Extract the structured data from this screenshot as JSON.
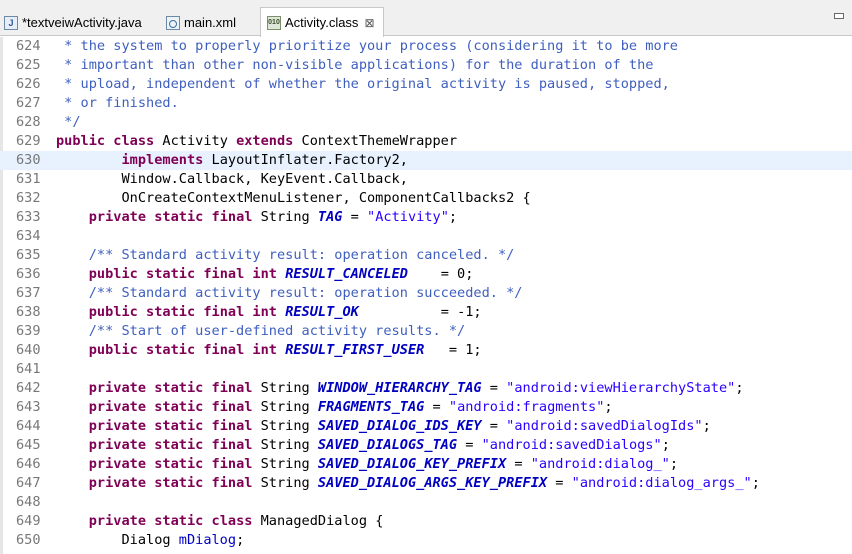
{
  "tabs": [
    {
      "label": "*textveiwActivity.java",
      "icon": "java-file-icon",
      "active": false
    },
    {
      "label": "main.xml",
      "icon": "xml-file-icon",
      "active": false
    },
    {
      "label": "Activity.class",
      "icon": "class-file-icon",
      "active": true
    }
  ],
  "close_glyph": "⊠",
  "colors": {
    "keyword": "#7f0055",
    "comment": "#3f5fbf",
    "string": "#2a00ff",
    "field": "#0000c0",
    "line_number": "#787878",
    "current_line": "#e8f2fe"
  },
  "editor": {
    "current_line": 630,
    "lines": [
      {
        "num": "624",
        "tokens": [
          {
            "t": " * the system to properly prioritize your process (considering it to be more",
            "c": "c"
          }
        ]
      },
      {
        "num": "625",
        "tokens": [
          {
            "t": " * important than other non-visible applications) for the duration of the",
            "c": "c"
          }
        ]
      },
      {
        "num": "626",
        "tokens": [
          {
            "t": " * upload, independent of whether the original activity is paused, stopped,",
            "c": "c"
          }
        ]
      },
      {
        "num": "627",
        "tokens": [
          {
            "t": " * or finished.",
            "c": "c"
          }
        ]
      },
      {
        "num": "628",
        "tokens": [
          {
            "t": " */",
            "c": "c"
          }
        ]
      },
      {
        "num": "629",
        "tokens": [
          {
            "t": "public class",
            "c": "k"
          },
          {
            "t": " Activity ",
            "c": ""
          },
          {
            "t": "extends",
            "c": "k"
          },
          {
            "t": " ContextThemeWrapper",
            "c": ""
          }
        ]
      },
      {
        "num": "630",
        "tokens": [
          {
            "t": "        ",
            "c": ""
          },
          {
            "t": "implements",
            "c": "k"
          },
          {
            "t": " LayoutInflater.Factory2,",
            "c": ""
          }
        ]
      },
      {
        "num": "631",
        "tokens": [
          {
            "t": "        Window.Callback, KeyEvent.Callback,",
            "c": ""
          }
        ]
      },
      {
        "num": "632",
        "tokens": [
          {
            "t": "        OnCreateContextMenuListener, ComponentCallbacks2 {",
            "c": ""
          }
        ]
      },
      {
        "num": "633",
        "tokens": [
          {
            "t": "    ",
            "c": ""
          },
          {
            "t": "private static final",
            "c": "k"
          },
          {
            "t": " String ",
            "c": ""
          },
          {
            "t": "TAG",
            "c": "f"
          },
          {
            "t": " = ",
            "c": ""
          },
          {
            "t": "\"Activity\"",
            "c": "s"
          },
          {
            "t": ";",
            "c": ""
          }
        ]
      },
      {
        "num": "634",
        "tokens": []
      },
      {
        "num": "635",
        "tokens": [
          {
            "t": "    /** Standard activity result: operation canceled. */",
            "c": "c"
          }
        ]
      },
      {
        "num": "636",
        "tokens": [
          {
            "t": "    ",
            "c": ""
          },
          {
            "t": "public static final int",
            "c": "k"
          },
          {
            "t": " ",
            "c": ""
          },
          {
            "t": "RESULT_CANCELED",
            "c": "f"
          },
          {
            "t": "    = 0;",
            "c": ""
          }
        ]
      },
      {
        "num": "637",
        "tokens": [
          {
            "t": "    /** Standard activity result: operation succeeded. */",
            "c": "c"
          }
        ]
      },
      {
        "num": "638",
        "tokens": [
          {
            "t": "    ",
            "c": ""
          },
          {
            "t": "public static final int",
            "c": "k"
          },
          {
            "t": " ",
            "c": ""
          },
          {
            "t": "RESULT_OK",
            "c": "f"
          },
          {
            "t": "          = -1;",
            "c": ""
          }
        ]
      },
      {
        "num": "639",
        "tokens": [
          {
            "t": "    /** Start of user-defined activity results. */",
            "c": "c"
          }
        ]
      },
      {
        "num": "640",
        "tokens": [
          {
            "t": "    ",
            "c": ""
          },
          {
            "t": "public static final int",
            "c": "k"
          },
          {
            "t": " ",
            "c": ""
          },
          {
            "t": "RESULT_FIRST_USER",
            "c": "f"
          },
          {
            "t": "   = 1;",
            "c": ""
          }
        ]
      },
      {
        "num": "641",
        "tokens": []
      },
      {
        "num": "642",
        "tokens": [
          {
            "t": "    ",
            "c": ""
          },
          {
            "t": "private static final",
            "c": "k"
          },
          {
            "t": " String ",
            "c": ""
          },
          {
            "t": "WINDOW_HIERARCHY_TAG",
            "c": "f"
          },
          {
            "t": " = ",
            "c": ""
          },
          {
            "t": "\"android:viewHierarchyState\"",
            "c": "s"
          },
          {
            "t": ";",
            "c": ""
          }
        ]
      },
      {
        "num": "643",
        "tokens": [
          {
            "t": "    ",
            "c": ""
          },
          {
            "t": "private static final",
            "c": "k"
          },
          {
            "t": " String ",
            "c": ""
          },
          {
            "t": "FRAGMENTS_TAG",
            "c": "f"
          },
          {
            "t": " = ",
            "c": ""
          },
          {
            "t": "\"android:fragments\"",
            "c": "s"
          },
          {
            "t": ";",
            "c": ""
          }
        ]
      },
      {
        "num": "644",
        "tokens": [
          {
            "t": "    ",
            "c": ""
          },
          {
            "t": "private static final",
            "c": "k"
          },
          {
            "t": " String ",
            "c": ""
          },
          {
            "t": "SAVED_DIALOG_IDS_KEY",
            "c": "f"
          },
          {
            "t": " = ",
            "c": ""
          },
          {
            "t": "\"android:savedDialogIds\"",
            "c": "s"
          },
          {
            "t": ";",
            "c": ""
          }
        ]
      },
      {
        "num": "645",
        "tokens": [
          {
            "t": "    ",
            "c": ""
          },
          {
            "t": "private static final",
            "c": "k"
          },
          {
            "t": " String ",
            "c": ""
          },
          {
            "t": "SAVED_DIALOGS_TAG",
            "c": "f"
          },
          {
            "t": " = ",
            "c": ""
          },
          {
            "t": "\"android:savedDialogs\"",
            "c": "s"
          },
          {
            "t": ";",
            "c": ""
          }
        ]
      },
      {
        "num": "646",
        "tokens": [
          {
            "t": "    ",
            "c": ""
          },
          {
            "t": "private static final",
            "c": "k"
          },
          {
            "t": " String ",
            "c": ""
          },
          {
            "t": "SAVED_DIALOG_KEY_PREFIX",
            "c": "f"
          },
          {
            "t": " = ",
            "c": ""
          },
          {
            "t": "\"android:dialog_\"",
            "c": "s"
          },
          {
            "t": ";",
            "c": ""
          }
        ]
      },
      {
        "num": "647",
        "tokens": [
          {
            "t": "    ",
            "c": ""
          },
          {
            "t": "private static final",
            "c": "k"
          },
          {
            "t": " String ",
            "c": ""
          },
          {
            "t": "SAVED_DIALOG_ARGS_KEY_PREFIX",
            "c": "f"
          },
          {
            "t": " = ",
            "c": ""
          },
          {
            "t": "\"android:dialog_args_\"",
            "c": "s"
          },
          {
            "t": ";",
            "c": ""
          }
        ]
      },
      {
        "num": "648",
        "tokens": []
      },
      {
        "num": "649",
        "tokens": [
          {
            "t": "    ",
            "c": ""
          },
          {
            "t": "private static class",
            "c": "k"
          },
          {
            "t": " ManagedDialog {",
            "c": ""
          }
        ]
      },
      {
        "num": "650",
        "tokens": [
          {
            "t": "        Dialog ",
            "c": ""
          },
          {
            "t": "mDialog",
            "c": "fv"
          },
          {
            "t": ";",
            "c": ""
          }
        ]
      }
    ]
  }
}
